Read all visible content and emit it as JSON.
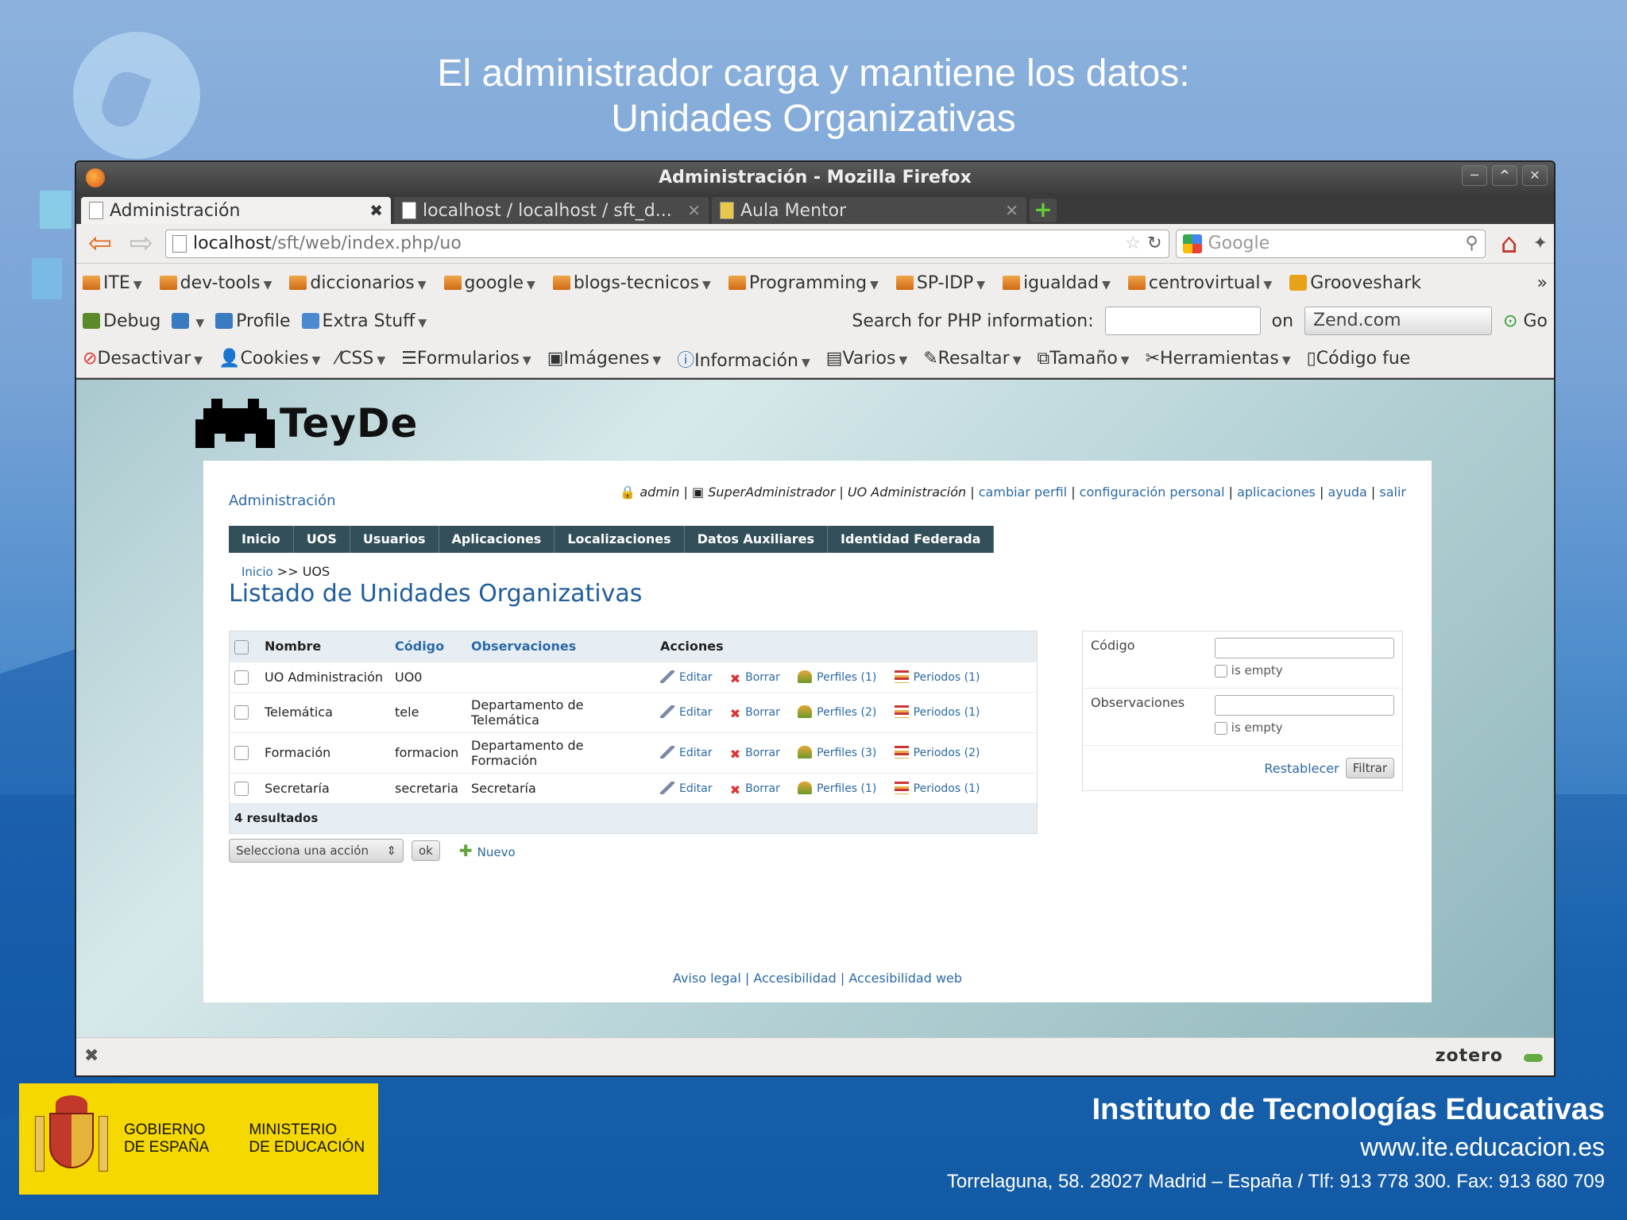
{
  "slide": {
    "title_line1": "El administrador carga y mantiene los datos:",
    "title_line2": "Unidades Organizativas"
  },
  "window": {
    "title": "Administración - Mozilla Firefox",
    "buttons": [
      "─",
      "^",
      "✕"
    ]
  },
  "tabs": [
    {
      "label": "Administración",
      "active": true
    },
    {
      "label": "localhost / localhost / sft_d...",
      "active": false
    },
    {
      "label": "Aula Mentor",
      "active": false
    }
  ],
  "navbar": {
    "url_host": "localhost",
    "url_path": "/sft/web/index.php/uo",
    "search_placeholder": "Google"
  },
  "bookmarks": [
    "ITE",
    "dev-tools",
    "diccionarios",
    "google",
    "blogs-tecnicos",
    "Programming",
    "SP-IDP",
    "igualdad",
    "centrovirtual",
    "Grooveshark"
  ],
  "firephp_bar": {
    "debug": "Debug",
    "profile": "Profile",
    "extra": "Extra Stuff",
    "search_label": "Search for PHP information:",
    "on": "on",
    "site": "Zend.com",
    "go": "Go"
  },
  "webdev_bar": [
    "Desactivar",
    "Cookies",
    "CSS",
    "Formularios",
    "Imágenes",
    "Información",
    "Varios",
    "Resaltar",
    "Tamaño",
    "Herramientas",
    "Código fue"
  ],
  "app": {
    "logo_text": "TeyDe",
    "section": "Administración",
    "user": "admin",
    "role": "SuperAdministrador",
    "uo": "UO Administración",
    "links": [
      "cambiar perfil",
      "configuración personal",
      "aplicaciones",
      "ayuda",
      "salir"
    ],
    "menu": [
      "Inicio",
      "UOS",
      "Usuarios",
      "Aplicaciones",
      "Localizaciones",
      "Datos Auxiliares",
      "Identidad Federada"
    ],
    "crumb_home": "Inicio",
    "crumb_sep": ">>",
    "crumb_current": "UOS",
    "heading": "Listado de Unidades Organizativas"
  },
  "table": {
    "headers": {
      "nombre": "Nombre",
      "codigo": "Código",
      "observaciones": "Observaciones",
      "acciones": "Acciones"
    },
    "rows": [
      {
        "nombre": "UO Administración",
        "codigo": "UO0",
        "obs": "",
        "editar": "Editar",
        "borrar": "Borrar",
        "perfiles": "Perfiles (1)",
        "periodos": "Periodos (1)"
      },
      {
        "nombre": "Telemática",
        "codigo": "tele",
        "obs": "Departamento de Telemática",
        "editar": "Editar",
        "borrar": "Borrar",
        "perfiles": "Perfiles (2)",
        "periodos": "Periodos (1)"
      },
      {
        "nombre": "Formación",
        "codigo": "formacion",
        "obs": "Departamento de Formación",
        "editar": "Editar",
        "borrar": "Borrar",
        "perfiles": "Perfiles (3)",
        "periodos": "Periodos (2)"
      },
      {
        "nombre": "Secretaría",
        "codigo": "secretaria",
        "obs": "Secretaría",
        "editar": "Editar",
        "borrar": "Borrar",
        "perfiles": "Perfiles (1)",
        "periodos": "Periodos (1)"
      }
    ],
    "results": "4 resultados"
  },
  "filters": {
    "codigo_label": "Código",
    "obs_label": "Observaciones",
    "is_empty": "is empty",
    "reset": "Restablecer",
    "filter": "Filtrar"
  },
  "batch": {
    "select": "Selecciona una acción",
    "ok": "ok",
    "new": "Nuevo"
  },
  "footer_links": "Aviso legal | Accesibilidad | Accesibilidad web",
  "statusbar": {
    "zotero": "zotero"
  },
  "org": {
    "gov1": "GOBIERNO",
    "gov2": "DE ESPAÑA",
    "min1": "MINISTERIO",
    "min2": "DE EDUCACIÓN",
    "name": "Instituto de Tecnologías Educativas",
    "url": "www.ite.educacion.es",
    "address": "Torrelaguna, 58. 28027 Madrid – España / Tlf: 913 778 300. Fax: 913 680 709"
  }
}
